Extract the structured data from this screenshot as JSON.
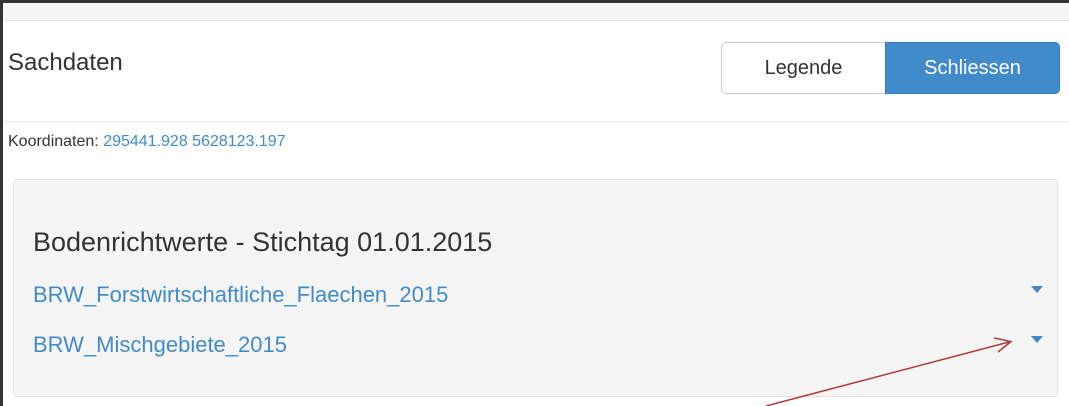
{
  "panel": {
    "title": "Sachdaten",
    "buttons": {
      "legend_label": "Legende",
      "close_label": "Schliessen"
    }
  },
  "coordinates": {
    "label": "Koordinaten:",
    "value": "295441.928 5628123.197"
  },
  "result": {
    "title": "Bodenrichtwerte - Stichtag 01.01.2015",
    "layers": [
      {
        "label": "BRW_Forstwirtschaftliche_Flaechen_2015",
        "expand_icon": "caret-down-icon"
      },
      {
        "label": "BRW_Mischgebiete_2015",
        "expand_icon": "caret-down-icon"
      }
    ]
  },
  "colors": {
    "primary": "#428bca",
    "well_background": "#f5f5f5",
    "annotation_arrow": "#b03a3a",
    "text": "#333333"
  }
}
